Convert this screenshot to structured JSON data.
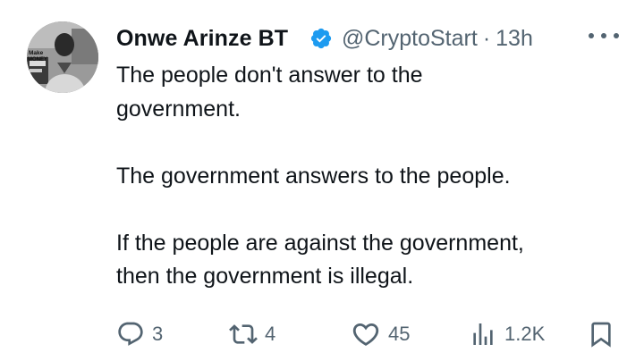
{
  "author": {
    "name": "Onwe Arinze BT",
    "handle": "@CryptoStart",
    "separator": "·",
    "time": "13h",
    "verified": true,
    "avatar_text_line1": "Make",
    "avatar_text_line2": "MONEY"
  },
  "post": {
    "lines": [
      "The people don't answer to the",
      "government.",
      "",
      "The government answers to the people.",
      "",
      "If the people are against the government,",
      "then the government is illegal."
    ]
  },
  "actions": {
    "replies": "3",
    "reposts": "4",
    "likes": "45",
    "views": "1.2K"
  },
  "colors": {
    "text": "#0f1419",
    "muted": "#536471",
    "verified": "#1d9bf0",
    "background": "#ffffff"
  },
  "icons": [
    "more-icon",
    "verified-badge-icon",
    "reply-icon",
    "repost-icon",
    "like-icon",
    "views-icon",
    "bookmark-icon"
  ]
}
